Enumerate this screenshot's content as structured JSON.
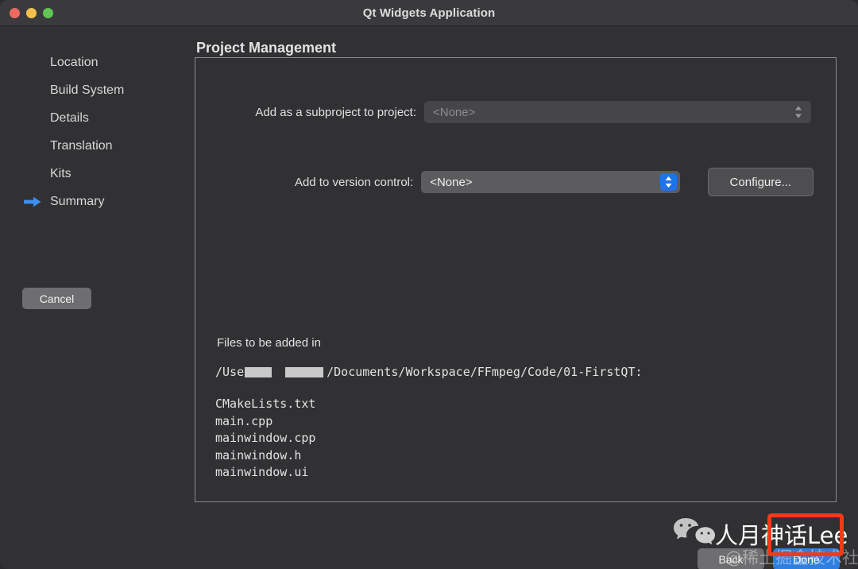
{
  "window": {
    "title": "Qt Widgets Application",
    "traffic_lights": [
      "close-button",
      "minimize-button",
      "maximize-button"
    ]
  },
  "sidebar": {
    "items": [
      {
        "label": "Location",
        "active": false
      },
      {
        "label": "Build System",
        "active": false
      },
      {
        "label": "Details",
        "active": false
      },
      {
        "label": "Translation",
        "active": false
      },
      {
        "label": "Kits",
        "active": false
      },
      {
        "label": "Summary",
        "active": true
      }
    ],
    "active_indicator_icon": "blue-right-arrow-icon",
    "cancel_label": "Cancel"
  },
  "main": {
    "page_title": "Project Management",
    "subproject": {
      "label": "Add as a subproject to project:",
      "value": "<None>",
      "enabled": false,
      "stepper_icon": "chevron-up-down-icon"
    },
    "version_control": {
      "label": "Add to version control:",
      "value": "<None>",
      "enabled": true,
      "stepper_icon": "chevron-up-down-icon",
      "configure_label": "Configure..."
    },
    "files": {
      "heading": "Files to be added in",
      "path_prefix": "/Use",
      "path_suffix": "/Documents/Workspace/FFmpeg/Code/01-FirstQT:",
      "redacted": true,
      "list": [
        "CMakeLists.txt",
        "main.cpp",
        "mainwindow.cpp",
        "mainwindow.h",
        "mainwindow.ui"
      ]
    }
  },
  "footer": {
    "back_label": "Back",
    "done_label": "Done"
  },
  "overlay": {
    "wechat_icon": "wechat-logo-icon",
    "brand_text": "人月神话Lee",
    "community_text": "@稀土掘金技术社区",
    "highlight_color": "#f03a1b"
  },
  "colors": {
    "window_bg": "#313133",
    "titlebar_bg": "#3a3a3d",
    "accent_blue": "#2f7fe0",
    "stepper_blue": "#1f72e8",
    "panel_border": "#8a8a8c"
  }
}
